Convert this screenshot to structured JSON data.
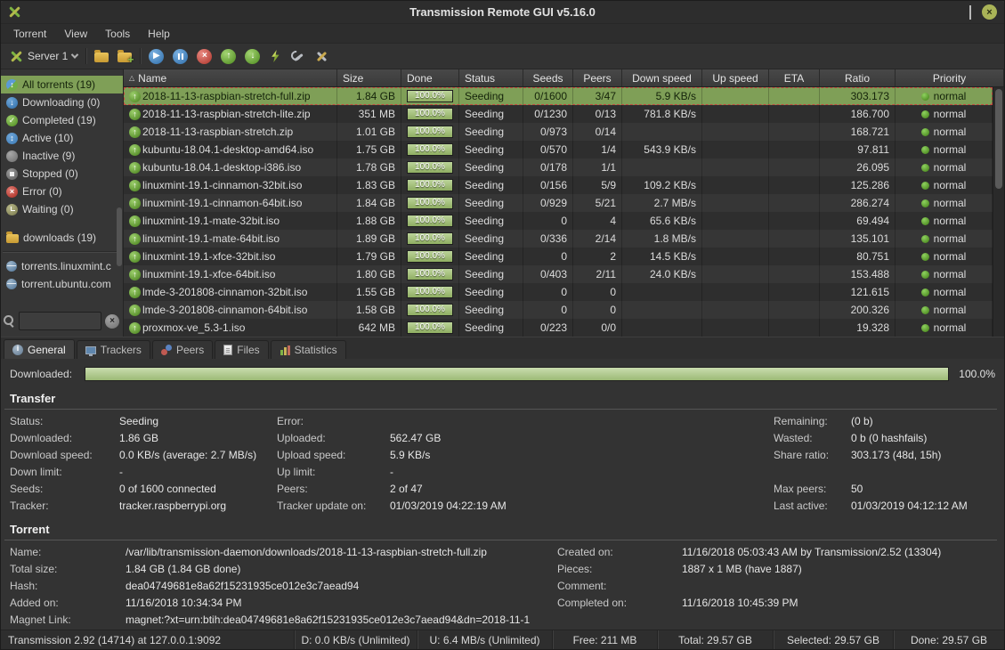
{
  "window": {
    "title": "Transmission Remote GUI v5.16.0"
  },
  "menu": {
    "items": [
      "Torrent",
      "View",
      "Tools",
      "Help"
    ]
  },
  "toolbar": {
    "server_label": "Server 1"
  },
  "sidebar": {
    "filters": [
      {
        "label": "All torrents (19)",
        "icon": "all",
        "selected": true
      },
      {
        "label": "Downloading (0)",
        "icon": "downloading",
        "selected": false
      },
      {
        "label": "Completed (19)",
        "icon": "completed",
        "selected": false
      },
      {
        "label": "Active (10)",
        "icon": "active",
        "selected": false
      },
      {
        "label": "Inactive (9)",
        "icon": "inactive",
        "selected": false
      },
      {
        "label": "Stopped (0)",
        "icon": "stopped",
        "selected": false
      },
      {
        "label": "Error (0)",
        "icon": "error",
        "selected": false
      },
      {
        "label": "Waiting (0)",
        "icon": "waiting",
        "selected": false
      }
    ],
    "folder": {
      "label": "downloads (19)"
    },
    "trackers": [
      {
        "label": "torrents.linuxmint.c"
      },
      {
        "label": "torrent.ubuntu.com"
      }
    ],
    "search": {
      "value": ""
    }
  },
  "table": {
    "columns": [
      {
        "key": "name",
        "label": "Name",
        "sort": true
      },
      {
        "key": "size",
        "label": "Size"
      },
      {
        "key": "done",
        "label": "Done"
      },
      {
        "key": "status",
        "label": "Status"
      },
      {
        "key": "seeds",
        "label": "Seeds",
        "center": true
      },
      {
        "key": "peers",
        "label": "Peers",
        "center": true
      },
      {
        "key": "dspeed",
        "label": "Down speed",
        "center": true
      },
      {
        "key": "uspeed",
        "label": "Up speed",
        "center": true
      },
      {
        "key": "eta",
        "label": "ETA",
        "center": true
      },
      {
        "key": "ratio",
        "label": "Ratio",
        "center": true
      },
      {
        "key": "priority",
        "label": "Priority",
        "center": true
      }
    ],
    "rows": [
      {
        "name": "2018-11-13-raspbian-stretch-full.zip",
        "size": "1.84 GB",
        "done": "100.0%",
        "status": "Seeding",
        "seeds": "0/1600",
        "peers": "3/47",
        "down_speed": "5.9 KB/s",
        "up_speed": "",
        "eta": "",
        "ratio": "303.173",
        "priority": "normal",
        "selected": true
      },
      {
        "name": "2018-11-13-raspbian-stretch-lite.zip",
        "size": "351 MB",
        "done": "100.0%",
        "status": "Seeding",
        "seeds": "0/1230",
        "peers": "0/13",
        "down_speed": "781.8 KB/s",
        "up_speed": "",
        "eta": "",
        "ratio": "186.700",
        "priority": "normal",
        "selected": false
      },
      {
        "name": "2018-11-13-raspbian-stretch.zip",
        "size": "1.01 GB",
        "done": "100.0%",
        "status": "Seeding",
        "seeds": "0/973",
        "peers": "0/14",
        "down_speed": "",
        "up_speed": "",
        "eta": "",
        "ratio": "168.721",
        "priority": "normal",
        "selected": false
      },
      {
        "name": "kubuntu-18.04.1-desktop-amd64.iso",
        "size": "1.75 GB",
        "done": "100.0%",
        "status": "Seeding",
        "seeds": "0/570",
        "peers": "1/4",
        "down_speed": "543.9 KB/s",
        "up_speed": "",
        "eta": "",
        "ratio": "97.811",
        "priority": "normal",
        "selected": false
      },
      {
        "name": "kubuntu-18.04.1-desktop-i386.iso",
        "size": "1.78 GB",
        "done": "100.0%",
        "status": "Seeding",
        "seeds": "0/178",
        "peers": "1/1",
        "down_speed": "",
        "up_speed": "",
        "eta": "",
        "ratio": "26.095",
        "priority": "normal",
        "selected": false
      },
      {
        "name": "linuxmint-19.1-cinnamon-32bit.iso",
        "size": "1.83 GB",
        "done": "100.0%",
        "status": "Seeding",
        "seeds": "0/156",
        "peers": "5/9",
        "down_speed": "109.2 KB/s",
        "up_speed": "",
        "eta": "",
        "ratio": "125.286",
        "priority": "normal",
        "selected": false
      },
      {
        "name": "linuxmint-19.1-cinnamon-64bit.iso",
        "size": "1.84 GB",
        "done": "100.0%",
        "status": "Seeding",
        "seeds": "0/929",
        "peers": "5/21",
        "down_speed": "2.7 MB/s",
        "up_speed": "",
        "eta": "",
        "ratio": "286.274",
        "priority": "normal",
        "selected": false
      },
      {
        "name": "linuxmint-19.1-mate-32bit.iso",
        "size": "1.88 GB",
        "done": "100.0%",
        "status": "Seeding",
        "seeds": "0",
        "peers": "4",
        "down_speed": "65.6 KB/s",
        "up_speed": "",
        "eta": "",
        "ratio": "69.494",
        "priority": "normal",
        "selected": false
      },
      {
        "name": "linuxmint-19.1-mate-64bit.iso",
        "size": "1.89 GB",
        "done": "100.0%",
        "status": "Seeding",
        "seeds": "0/336",
        "peers": "2/14",
        "down_speed": "1.8 MB/s",
        "up_speed": "",
        "eta": "",
        "ratio": "135.101",
        "priority": "normal",
        "selected": false
      },
      {
        "name": "linuxmint-19.1-xfce-32bit.iso",
        "size": "1.79 GB",
        "done": "100.0%",
        "status": "Seeding",
        "seeds": "0",
        "peers": "2",
        "down_speed": "14.5 KB/s",
        "up_speed": "",
        "eta": "",
        "ratio": "80.751",
        "priority": "normal",
        "selected": false
      },
      {
        "name": "linuxmint-19.1-xfce-64bit.iso",
        "size": "1.80 GB",
        "done": "100.0%",
        "status": "Seeding",
        "seeds": "0/403",
        "peers": "2/11",
        "down_speed": "24.0 KB/s",
        "up_speed": "",
        "eta": "",
        "ratio": "153.488",
        "priority": "normal",
        "selected": false
      },
      {
        "name": "lmde-3-201808-cinnamon-32bit.iso",
        "size": "1.55 GB",
        "done": "100.0%",
        "status": "Seeding",
        "seeds": "0",
        "peers": "0",
        "down_speed": "",
        "up_speed": "",
        "eta": "",
        "ratio": "121.615",
        "priority": "normal",
        "selected": false
      },
      {
        "name": "lmde-3-201808-cinnamon-64bit.iso",
        "size": "1.58 GB",
        "done": "100.0%",
        "status": "Seeding",
        "seeds": "0",
        "peers": "0",
        "down_speed": "",
        "up_speed": "",
        "eta": "",
        "ratio": "200.326",
        "priority": "normal",
        "selected": false
      },
      {
        "name": "proxmox-ve_5.3-1.iso",
        "size": "642 MB",
        "done": "100.0%",
        "status": "Seeding",
        "seeds": "0/223",
        "peers": "0/0",
        "down_speed": "",
        "up_speed": "",
        "eta": "",
        "ratio": "19.328",
        "priority": "normal",
        "selected": false
      }
    ]
  },
  "tabs": {
    "active_index": 0,
    "items": [
      {
        "label": "General",
        "icon": "general"
      },
      {
        "label": "Trackers",
        "icon": "trackers"
      },
      {
        "label": "Peers",
        "icon": "peers"
      },
      {
        "label": "Files",
        "icon": "files"
      },
      {
        "label": "Statistics",
        "icon": "statistics"
      }
    ]
  },
  "details": {
    "downloaded_label": "Downloaded:",
    "downloaded_percent": "100.0%",
    "downloaded_value": 100,
    "transfer": {
      "title": "Transfer",
      "rows": [
        [
          {
            "l": "Status:",
            "v": "Seeding"
          },
          {
            "l": "Error:",
            "v": ""
          },
          {
            "l": "Remaining:",
            "v": "(0 b)"
          }
        ],
        [
          {
            "l": "Downloaded:",
            "v": "1.86 GB"
          },
          {
            "l": "Uploaded:",
            "v": "562.47 GB"
          },
          {
            "l": "Wasted:",
            "v": "0 b (0 hashfails)"
          }
        ],
        [
          {
            "l": "Download speed:",
            "v": "0.0 KB/s (average: 2.7 MB/s)"
          },
          {
            "l": "Upload speed:",
            "v": "5.9 KB/s"
          },
          {
            "l": "Share ratio:",
            "v": "303.173 (48d, 15h)"
          }
        ],
        [
          {
            "l": "Down limit:",
            "v": "-"
          },
          {
            "l": "Up limit:",
            "v": "-"
          },
          {
            "l": "",
            "v": ""
          }
        ],
        [
          {
            "l": "Seeds:",
            "v": "0 of 1600 connected"
          },
          {
            "l": "Peers:",
            "v": "2 of 47"
          },
          {
            "l": "Max peers:",
            "v": "50"
          }
        ],
        [
          {
            "l": "Tracker:",
            "v": "tracker.raspberrypi.org"
          },
          {
            "l": "Tracker update on:",
            "v": "01/03/2019 04:22:19 AM"
          },
          {
            "l": "Last active:",
            "v": "01/03/2019 04:12:12 AM"
          }
        ]
      ]
    },
    "torrent": {
      "title": "Torrent",
      "rows": [
        [
          {
            "l": "Name:",
            "v": "/var/lib/transmission-daemon/downloads/2018-11-13-raspbian-stretch-full.zip"
          },
          {
            "l": "Created on:",
            "v": "11/16/2018 05:03:43 AM by Transmission/2.52 (13304)"
          }
        ],
        [
          {
            "l": "Total size:",
            "v": "1.84 GB (1.84 GB done)"
          },
          {
            "l": "Pieces:",
            "v": "1887 x 1 MB (have 1887)"
          }
        ],
        [
          {
            "l": "Hash:",
            "v": "dea04749681e8a62f15231935ce012e3c7aead94"
          },
          {
            "l": "Comment:",
            "v": ""
          }
        ],
        [
          {
            "l": "Added on:",
            "v": "11/16/2018 10:34:34 PM"
          },
          {
            "l": "Completed on:",
            "v": "11/16/2018 10:45:39 PM"
          }
        ],
        [
          {
            "l": "Magnet Link:",
            "v": "magnet:?xt=urn:btih:dea04749681e8a62f15231935ce012e3c7aead94&dn=2018-11-1",
            "wide": true,
            "click": true
          }
        ]
      ]
    }
  },
  "statusbar": {
    "segments": [
      {
        "text": "Transmission 2.92 (14714) at 127.0.0.1:9092"
      },
      {
        "text": "D: 0.0 KB/s (Unlimited)"
      },
      {
        "text": "U: 6.4 MB/s (Unlimited)"
      },
      {
        "text": "Free: 211 MB"
      },
      {
        "text": "Total: 29.57 GB"
      },
      {
        "text": "Selected: 29.57 GB"
      },
      {
        "text": "Done: 29.57 GB"
      }
    ]
  }
}
